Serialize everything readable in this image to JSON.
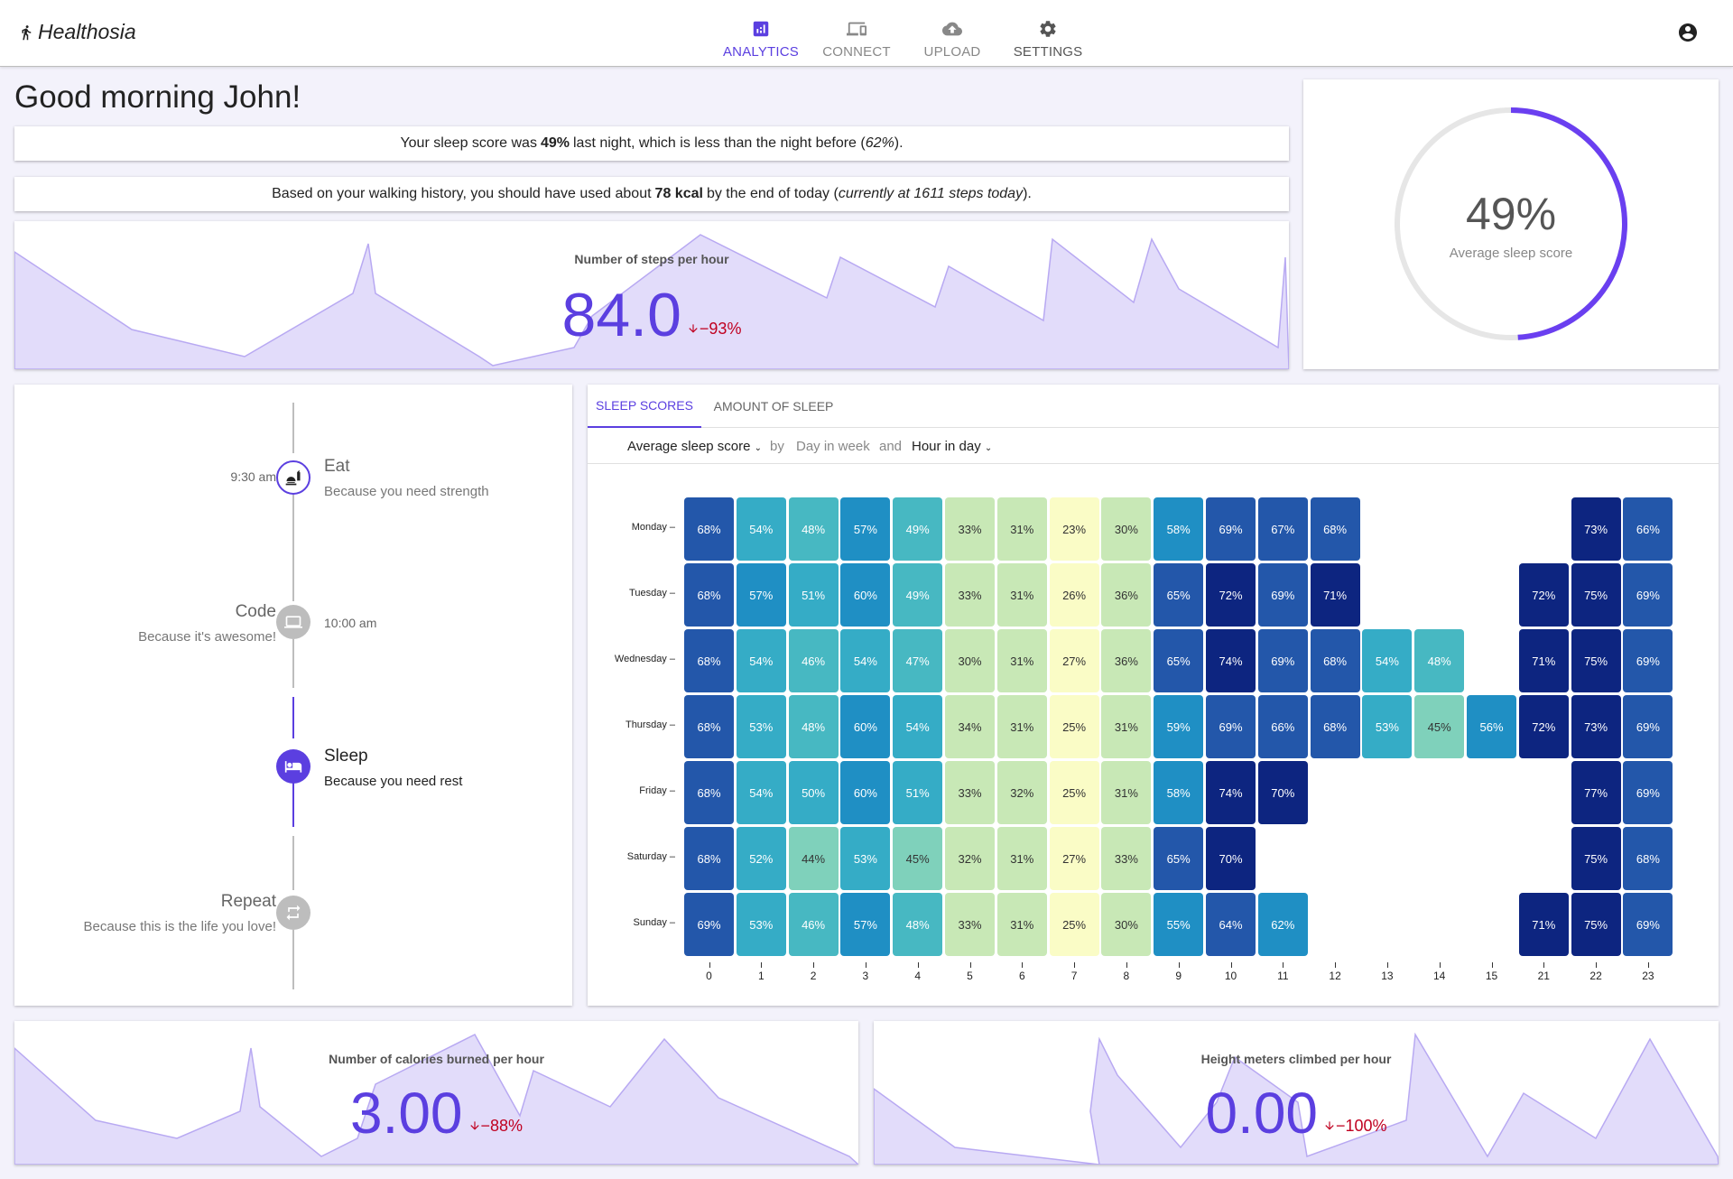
{
  "header": {
    "brand": "Healthosia",
    "nav": [
      {
        "label": "ANALYTICS",
        "icon": "analytics-icon",
        "active": true
      },
      {
        "label": "CONNECT",
        "icon": "devices-icon",
        "active": false
      },
      {
        "label": "UPLOAD",
        "icon": "cloud-upload-icon",
        "active": false
      },
      {
        "label": "SETTINGS",
        "icon": "gear-icon",
        "active": false
      }
    ],
    "account_icon": "account-circle-icon"
  },
  "greeting": "Good morning John!",
  "sleep_info": {
    "prefix": "Your sleep score was",
    "score": "49%",
    "middle": "last night, which is less than the night before (",
    "previous": "62%",
    "suffix": ")."
  },
  "walking_info": {
    "prefix": "Based on your walking history, you should have used about",
    "kcal": "78 kcal",
    "middle": "by the end of today (",
    "current": "currently at 1611 steps today",
    "suffix": ")."
  },
  "steps_card": {
    "title": "Number of steps per hour",
    "value": "84.0",
    "delta": "−93%"
  },
  "sleep_ring": {
    "value": "49%",
    "label": "Average sleep score",
    "fraction": 0.49
  },
  "timeline": [
    {
      "time": "9:30 am",
      "title": "Eat",
      "desc": "Because you need strength",
      "icon": "restaurant-icon"
    },
    {
      "time": "10:00 am",
      "title": "Code",
      "desc": "Because it's awesome!",
      "icon": "laptop-icon"
    },
    {
      "title": "Sleep",
      "desc": "Because you need rest",
      "icon": "hotel-icon"
    },
    {
      "title": "Repeat",
      "desc": "Because this is the life you love!",
      "icon": "repeat-icon"
    }
  ],
  "heatmap": {
    "tabs": [
      "SLEEP SCORES",
      "AMOUNT OF SLEEP"
    ],
    "selector": {
      "metric": "Average sleep score",
      "by": "by",
      "dim1": "Day in week",
      "and": "and",
      "dim2": "Hour in day"
    }
  },
  "calories_card": {
    "title": "Number of calories burned per hour",
    "value": "3.00",
    "delta": "−88%"
  },
  "height_card": {
    "title": "Height meters climbed per hour",
    "value": "0.00",
    "delta": "−100%"
  },
  "chart_data": {
    "type": "heatmap",
    "rows": [
      "Monday",
      "Tuesday",
      "Wednesday",
      "Thursday",
      "Friday",
      "Saturday",
      "Sunday"
    ],
    "columns": [
      "0",
      "1",
      "2",
      "3",
      "4",
      "5",
      "6",
      "7",
      "8",
      "9",
      "10",
      "11",
      "12",
      "13",
      "14",
      "15",
      "21",
      "22",
      "23"
    ],
    "values": [
      [
        68,
        54,
        48,
        57,
        49,
        33,
        31,
        23,
        30,
        58,
        69,
        67,
        68,
        null,
        null,
        null,
        null,
        73,
        66
      ],
      [
        68,
        57,
        51,
        60,
        49,
        33,
        31,
        26,
        36,
        65,
        72,
        69,
        71,
        null,
        null,
        null,
        72,
        75,
        69
      ],
      [
        68,
        54,
        46,
        54,
        47,
        30,
        31,
        27,
        36,
        65,
        74,
        69,
        68,
        54,
        48,
        null,
        71,
        75,
        69
      ],
      [
        68,
        53,
        48,
        60,
        54,
        34,
        31,
        25,
        31,
        59,
        69,
        66,
        68,
        53,
        45,
        56,
        72,
        73,
        69
      ],
      [
        68,
        54,
        50,
        60,
        51,
        33,
        32,
        25,
        31,
        58,
        74,
        70,
        null,
        null,
        null,
        null,
        null,
        77,
        69
      ],
      [
        68,
        52,
        44,
        53,
        45,
        32,
        31,
        27,
        33,
        65,
        70,
        null,
        null,
        null,
        null,
        null,
        null,
        75,
        68
      ],
      [
        69,
        53,
        46,
        57,
        48,
        33,
        31,
        25,
        30,
        55,
        64,
        62,
        null,
        null,
        null,
        null,
        71,
        75,
        69
      ]
    ],
    "unit": "%"
  }
}
